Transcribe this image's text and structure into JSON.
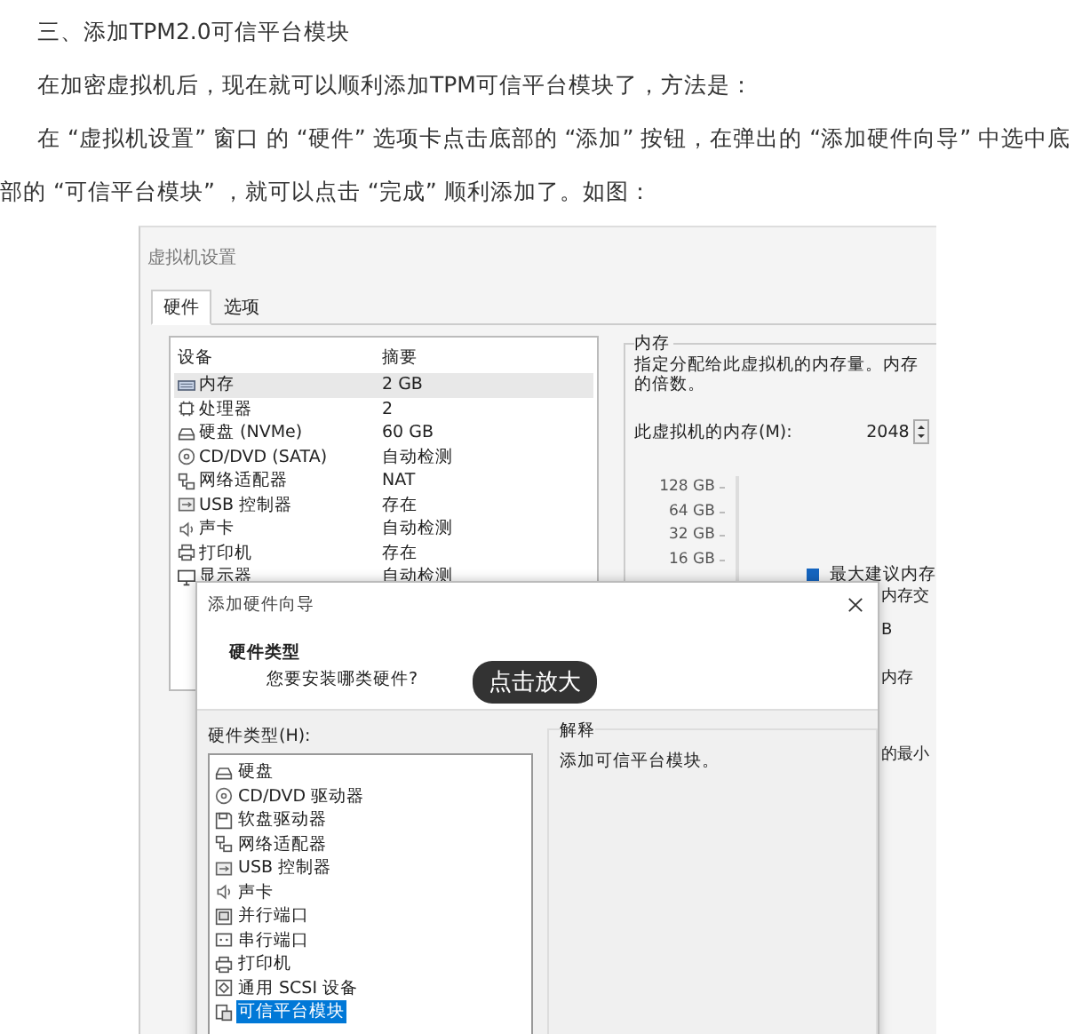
{
  "article": {
    "heading": "三、添加TPM2.0可信平台模块",
    "paragraphs": [
      "在加密虚拟机后，现在就可以顺利添加TPM可信平台模块了，方法是：",
      "在 “虚拟机设置” 窗口 的 “硬件” 选项卡点击底部的 “添加” 按钮，在弹出的 “添加硬件向导” 中选中底部的 “可信平台模块” ，就可以点击 “完成” 顺利添加了。如图："
    ]
  },
  "figure": {
    "settings_window": {
      "title": "虚拟机设置",
      "tabs": [
        {
          "label": "硬件",
          "selected": true
        },
        {
          "label": "选项",
          "selected": false
        }
      ],
      "device_columns": [
        "设备",
        "摘要"
      ],
      "devices": [
        {
          "kind": "memory",
          "name": "内存",
          "summary": "2 GB",
          "selected": true
        },
        {
          "kind": "cpu",
          "name": "处理器",
          "summary": "2",
          "selected": false
        },
        {
          "kind": "disk",
          "name": "硬盘 (NVMe)",
          "summary": "60 GB",
          "selected": false
        },
        {
          "kind": "disc",
          "name": "CD/DVD (SATA)",
          "summary": "自动检测",
          "selected": false
        },
        {
          "kind": "network",
          "name": "网络适配器",
          "summary": "NAT",
          "selected": false
        },
        {
          "kind": "usb",
          "name": "USB 控制器",
          "summary": "存在",
          "selected": false
        },
        {
          "kind": "sound",
          "name": "声卡",
          "summary": "自动检测",
          "selected": false
        },
        {
          "kind": "printer",
          "name": "打印机",
          "summary": "存在",
          "selected": false
        },
        {
          "kind": "monitor",
          "name": "显示器",
          "summary": "自动检测",
          "selected": false
        }
      ],
      "memory": {
        "group_title": "内存",
        "description": [
          "指定分配给此虚拟机的内存量。内存",
          "的倍数。"
        ],
        "field_label": "此虚拟机的内存(M):",
        "value": "2048",
        "scale": [
          "128 GB",
          "64 GB",
          "32 GB",
          "16 GB"
        ],
        "legend": "最大建议内存",
        "fragments": [
          "内存交",
          "B",
          "内存",
          "的最小"
        ]
      }
    },
    "wizard": {
      "title": "添加硬件向导",
      "section_title": "硬件类型",
      "section_subtitle": "您要安装哪类硬件?",
      "list_label": "硬件类型(H):",
      "hardware_types": [
        {
          "kind": "disk",
          "name": "硬盘",
          "selected": false
        },
        {
          "kind": "disc",
          "name": "CD/DVD 驱动器",
          "selected": false
        },
        {
          "kind": "floppy",
          "name": "软盘驱动器",
          "selected": false
        },
        {
          "kind": "network",
          "name": "网络适配器",
          "selected": false
        },
        {
          "kind": "usb",
          "name": "USB 控制器",
          "selected": false
        },
        {
          "kind": "sound",
          "name": "声卡",
          "selected": false
        },
        {
          "kind": "parallel",
          "name": "并行端口",
          "selected": false
        },
        {
          "kind": "serial",
          "name": "串行端口",
          "selected": false
        },
        {
          "kind": "printer",
          "name": "打印机",
          "selected": false
        },
        {
          "kind": "scsi",
          "name": "通用 SCSI 设备",
          "selected": false
        },
        {
          "kind": "tpm",
          "name": "可信平台模块",
          "selected": true
        }
      ],
      "explanation_title": "解释",
      "explanation": "添加可信平台模块。"
    },
    "zoom_button": "点击放大"
  }
}
